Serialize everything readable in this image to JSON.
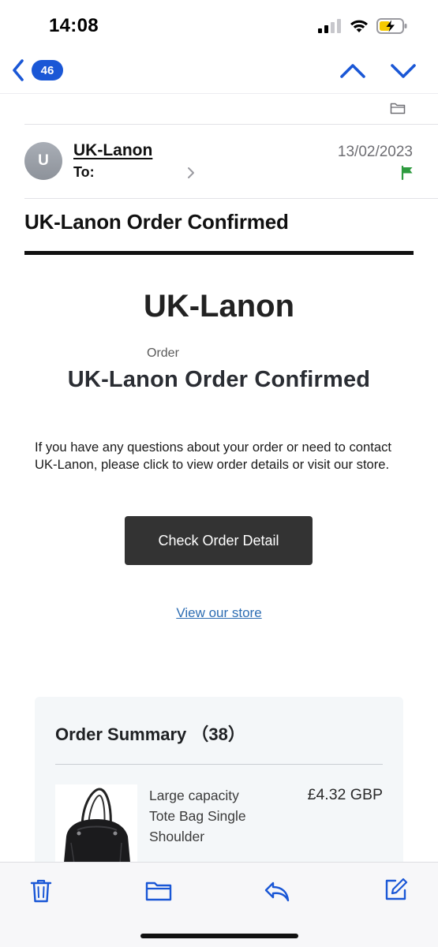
{
  "status_bar": {
    "time": "14:08"
  },
  "nav": {
    "unread_count": "46"
  },
  "header": {
    "avatar_initial": "U",
    "sender": "UK-Lanon",
    "to_label": "To:",
    "date": "13/02/2023"
  },
  "subject": "UK-Lanon Order Confirmed",
  "email": {
    "brand": "UK-Lanon",
    "order_label": "Order",
    "confirm_title": "UK-Lanon Order Confirmed",
    "body": "If you have any questions about your order or need to contact UK-Lanon, please click to view order details or visit our store.",
    "cta_label": "Check Order Detail",
    "store_link": "View our store"
  },
  "summary": {
    "title": "Order Summary （38）",
    "items": [
      {
        "name": "Large capacity Tote Bag Single Shoulder",
        "price": "£4.32 GBP"
      }
    ]
  },
  "colors": {
    "accent": "#1a57d6",
    "flag": "#2e9b3f",
    "cta_bg": "#333333",
    "link": "#2d6db3"
  },
  "icons": {
    "back": "chevron-left-icon",
    "prev": "chevron-up-icon",
    "next": "chevron-down-icon",
    "folder": "folder-icon",
    "flag": "flag-icon",
    "trash": "trash-icon",
    "move": "folder-icon",
    "reply": "reply-icon",
    "compose": "compose-icon"
  }
}
